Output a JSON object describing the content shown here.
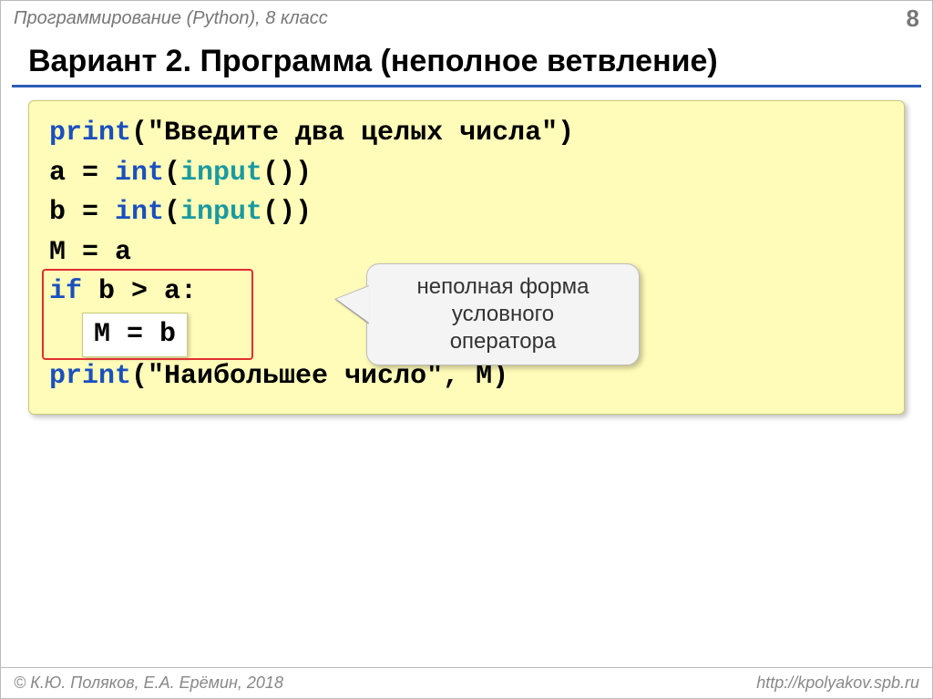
{
  "header": {
    "course": "Программирование (Python), 8 класс",
    "page": "8"
  },
  "title": "Вариант 2. Программа (неполное ветвление)",
  "code": {
    "l1_print": "print",
    "l1_rest": "(\"Введите два целых числа\")",
    "l2_a": "a = ",
    "l2_int": "int",
    "l2_paren1": "(",
    "l2_input": "input",
    "l2_paren2": "())",
    "l3_b": "b = ",
    "l3_int": "int",
    "l3_paren1": "(",
    "l3_input": "input",
    "l3_paren2": "())",
    "l4": "M = a",
    "l5_if": "if",
    "l5_rest": " b > a:",
    "l6": "M = b",
    "l7_print": "print",
    "l7_rest": "(\"Наибольшее число\", M)"
  },
  "callout": {
    "line1": "неполная форма",
    "line2": "условного",
    "line3": "оператора"
  },
  "footer": {
    "copyright": "© К.Ю. Поляков, Е.А. Ерёмин, 2018",
    "url": "http://kpolyakov.spb.ru"
  }
}
